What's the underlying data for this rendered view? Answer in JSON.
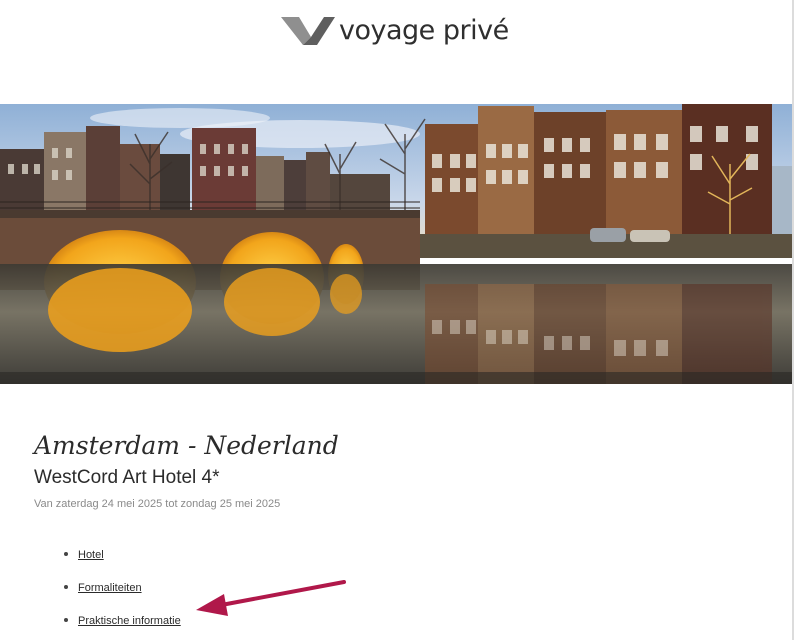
{
  "brand": {
    "logo_text": "voyage privé",
    "accent_color": "#8a8a8a"
  },
  "hero": {
    "scene": "Amsterdam canal with arched bridge and canal houses at sunrise"
  },
  "offer": {
    "destination": "Amsterdam - Nederland",
    "hotel": "WestCord Art Hotel 4*",
    "dates": "Van zaterdag 24 mei 2025 tot zondag 25 mei 2025"
  },
  "nav": {
    "items": [
      {
        "label": "Hotel"
      },
      {
        "label": "Formaliteiten"
      },
      {
        "label": "Praktische informatie"
      }
    ]
  },
  "annotation": {
    "arrow_color": "#b0184a",
    "points_to": "Praktische informatie"
  }
}
